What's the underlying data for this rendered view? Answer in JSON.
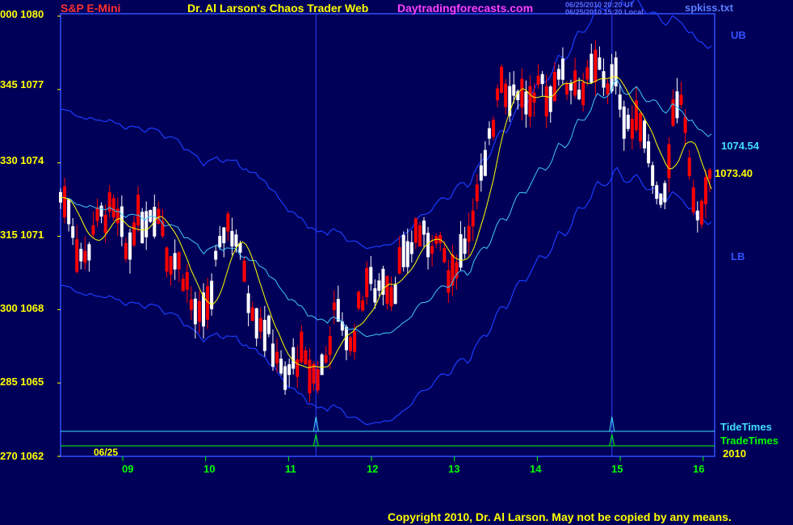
{
  "header": {
    "symbol": "S&P E-Mini",
    "title": "Dr. Al Larson's Chaos Trader Web",
    "site": "Daytradingforecasts.com",
    "stamp_utc": "06/25/2010 20:20 UT",
    "stamp_local": "06/25/2010 15:20 Local",
    "file": "spkiss.txt"
  },
  "footer": {
    "copyright": "Copyright 2010, Dr. Al Larson. May not be copied by any means.",
    "date": "06/25",
    "year": "2010"
  },
  "colors": {
    "background": "#000058",
    "up_candle": "#ffffff",
    "down_candle": "#ff0000",
    "fast_ma": "#ffff00",
    "slow_ma": "#40c8ff",
    "bands": "#1a3cff",
    "tide": "#40e0ff",
    "trade": "#00ff00"
  },
  "chart_data": {
    "type": "candlestick",
    "title": "S&P E-Mini",
    "yaxis": {
      "range": [
        1062,
        1080
      ],
      "ticks": [
        {
          "value": 1080,
          "label": "000 1080"
        },
        {
          "value": 1077,
          "label": "345 1077"
        },
        {
          "value": 1074,
          "label": "330 1074"
        },
        {
          "value": 1071,
          "label": "315 1071"
        },
        {
          "value": 1068,
          "label": "300 1068"
        },
        {
          "value": 1065,
          "label": "285 1065"
        },
        {
          "value": 1062,
          "label": "270 1062"
        }
      ]
    },
    "xaxis": {
      "range": [
        8.25,
        16.1
      ],
      "ticks": [
        "09",
        "10",
        "11",
        "12",
        "13",
        "14",
        "15",
        "16"
      ],
      "tick_values": [
        9,
        10,
        11,
        12,
        13,
        14,
        15,
        16
      ]
    },
    "grid": false,
    "vertical_markers": [
      11.33,
      14.9
    ],
    "series_labels": {
      "upper_band": "UB",
      "lower_band": "LB",
      "slow_ma_last": "1074.54",
      "fast_ma_last": "1073.40",
      "tide_times": "TideTimes",
      "trade_times": "TradeTimes"
    },
    "last_values": {
      "slow_ma": 1074.54,
      "fast_ma": 1073.4
    },
    "closes": [
      [
        8.25,
        1072.6
      ],
      [
        8.35,
        1072.2
      ],
      [
        8.45,
        1070.5
      ],
      [
        8.55,
        1070.0
      ],
      [
        8.65,
        1071.4
      ],
      [
        8.75,
        1071.8
      ],
      [
        8.85,
        1072.0
      ],
      [
        8.95,
        1071.6
      ],
      [
        9.05,
        1070.3
      ],
      [
        9.15,
        1071.6
      ],
      [
        9.25,
        1071.7
      ],
      [
        9.35,
        1072.1
      ],
      [
        9.45,
        1071.8
      ],
      [
        9.55,
        1070.2
      ],
      [
        9.65,
        1070.0
      ],
      [
        9.75,
        1069.3
      ],
      [
        9.85,
        1068.0
      ],
      [
        9.95,
        1067.5
      ],
      [
        10.05,
        1068.5
      ],
      [
        10.15,
        1070.2
      ],
      [
        10.25,
        1071.6
      ],
      [
        10.35,
        1071.0
      ],
      [
        10.45,
        1069.9
      ],
      [
        10.55,
        1068.2
      ],
      [
        10.65,
        1067.6
      ],
      [
        10.75,
        1067.0
      ],
      [
        10.85,
        1066.2
      ],
      [
        10.95,
        1065.0
      ],
      [
        11.05,
        1065.8
      ],
      [
        11.15,
        1066.1
      ],
      [
        11.25,
        1065.4
      ],
      [
        11.35,
        1065.3
      ],
      [
        11.45,
        1066.0
      ],
      [
        11.55,
        1067.8
      ],
      [
        11.65,
        1067.5
      ],
      [
        11.75,
        1066.4
      ],
      [
        11.85,
        1068.0
      ],
      [
        11.95,
        1069.2
      ],
      [
        12.05,
        1068.8
      ],
      [
        12.15,
        1069.4
      ],
      [
        12.25,
        1068.7
      ],
      [
        12.35,
        1069.8
      ],
      [
        12.45,
        1070.4
      ],
      [
        12.55,
        1071.2
      ],
      [
        12.65,
        1070.9
      ],
      [
        12.75,
        1070.8
      ],
      [
        12.85,
        1070.4
      ],
      [
        12.95,
        1069.0
      ],
      [
        13.05,
        1070.2
      ],
      [
        13.15,
        1071.0
      ],
      [
        13.25,
        1072.4
      ],
      [
        13.35,
        1073.5
      ],
      [
        13.45,
        1075.3
      ],
      [
        13.55,
        1077.6
      ],
      [
        13.65,
        1076.9
      ],
      [
        13.75,
        1077.0
      ],
      [
        13.85,
        1076.6
      ],
      [
        13.95,
        1076.2
      ],
      [
        14.05,
        1077.3
      ],
      [
        14.15,
        1076.6
      ],
      [
        14.25,
        1077.9
      ],
      [
        14.35,
        1077.2
      ],
      [
        14.45,
        1077.4
      ],
      [
        14.55,
        1076.9
      ],
      [
        14.65,
        1077.6
      ],
      [
        14.75,
        1077.9
      ],
      [
        14.85,
        1077.2
      ],
      [
        14.95,
        1077.4
      ],
      [
        15.05,
        1076.0
      ],
      [
        15.15,
        1075.4
      ],
      [
        15.25,
        1075.8
      ],
      [
        15.35,
        1074.6
      ],
      [
        15.45,
        1072.6
      ],
      [
        15.55,
        1073.0
      ],
      [
        15.65,
        1075.8
      ],
      [
        15.75,
        1076.6
      ],
      [
        15.85,
        1073.2
      ],
      [
        15.95,
        1071.6
      ],
      [
        16.05,
        1072.8
      ],
      [
        16.1,
        1073.4
      ]
    ]
  }
}
